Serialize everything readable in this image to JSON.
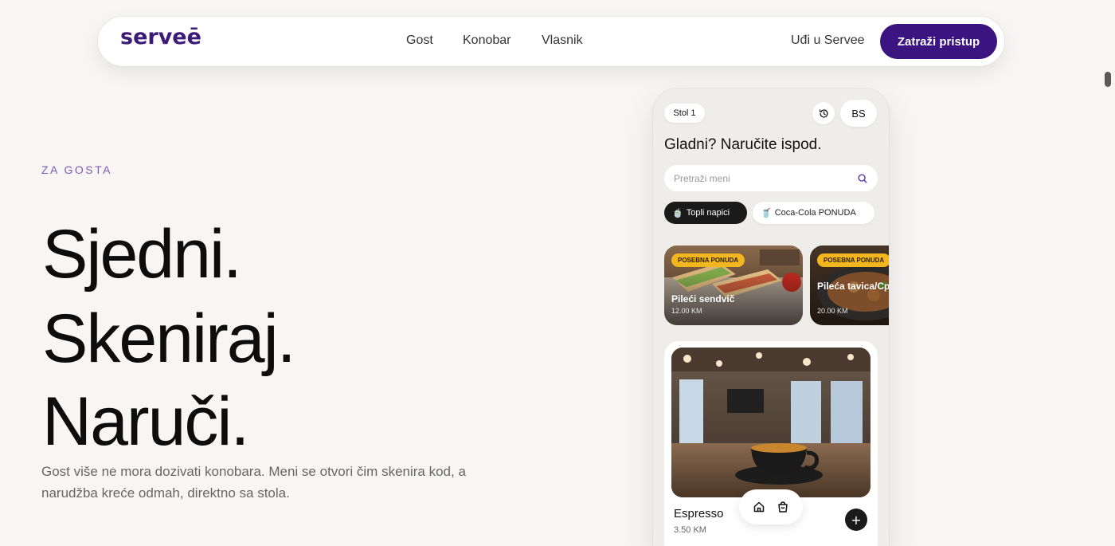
{
  "nav": {
    "logo": "serveē",
    "links": [
      "Gost",
      "Konobar",
      "Vlasnik"
    ],
    "login": "Uđi u Servee",
    "cta": "Zatraži pristup"
  },
  "hero": {
    "eyebrow": "ZA GOSTA",
    "line1": "Sjedni.",
    "line2": "Skeniraj.",
    "line3": "Naruči.",
    "lead": "Gost više ne mora dozivati konobara. Meni se otvori čim skenira kod, a narudžba kreće odmah, direktno sa stola."
  },
  "phone": {
    "table": "Stol 1",
    "lang": "BS",
    "title": "Gladni? Naručite ispod.",
    "search_placeholder": "Pretraži meni",
    "chips": [
      {
        "emoji": "🍵",
        "label": "Topli napici",
        "active": true
      },
      {
        "emoji": "🥤",
        "label": "Coca-Cola PONUDA",
        "active": false
      }
    ],
    "specials": [
      {
        "badge": "POSEBNA PONUDA",
        "name": "Pileći sendvič",
        "price": "12.00 KM"
      },
      {
        "badge": "POSEBNA PONUDA",
        "name": "Pileća tavica/Cpan",
        "price": "20.00 KM"
      }
    ],
    "product": {
      "name": "Espresso",
      "price": "3.50 KM",
      "add": "+"
    },
    "icons": {
      "history": "history-icon",
      "search": "search-icon",
      "home": "home-icon",
      "cart": "cart-icon"
    }
  },
  "colors": {
    "brand": "#3a1480",
    "badge": "#f2b61f",
    "eyebrow": "#7b5bb0"
  }
}
